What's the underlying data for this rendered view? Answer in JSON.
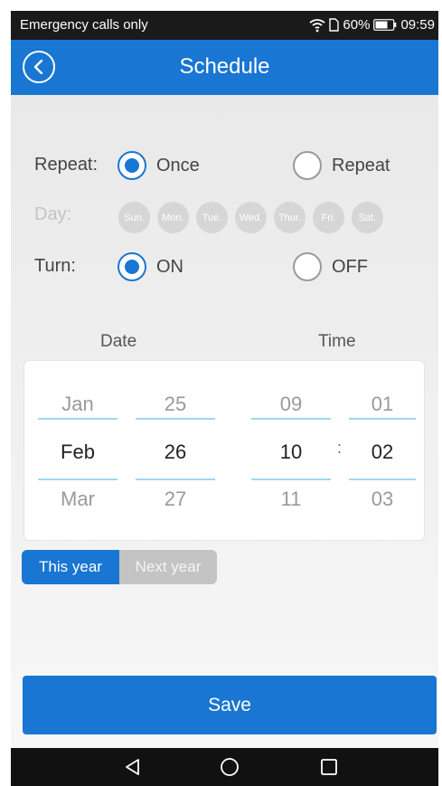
{
  "statusbar": {
    "carrier": "Emergency calls only",
    "battery": "60%",
    "time": "09:59"
  },
  "header": {
    "title": "Schedule"
  },
  "repeat": {
    "label": "Repeat:",
    "option_once": "Once",
    "option_repeat": "Repeat",
    "selected": "Once"
  },
  "day": {
    "label": "Day:",
    "days": [
      "Sun.",
      "Mon.",
      "Tue.",
      "Wed.",
      "Thur.",
      "Fri.",
      "Sat."
    ]
  },
  "turn": {
    "label": "Turn:",
    "option_on": "ON",
    "option_off": "OFF",
    "selected": "ON"
  },
  "picker": {
    "date_header": "Date",
    "time_header": "Time",
    "month": {
      "prev": "Jan",
      "current": "Feb",
      "next": "Mar"
    },
    "day": {
      "prev": "25",
      "current": "26",
      "next": "27"
    },
    "hour": {
      "prev": "09",
      "current": "10",
      "next": "11"
    },
    "minute": {
      "prev": "01",
      "current": "02",
      "next": "03"
    },
    "separator": ":"
  },
  "year_toggle": {
    "this_year": "This year",
    "next_year": "Next year",
    "selected": "This year"
  },
  "save_label": "Save",
  "colors": {
    "accent": "#1976d2",
    "wheel_line": "#9fd8ef",
    "disabled": "#d6d6d6"
  }
}
